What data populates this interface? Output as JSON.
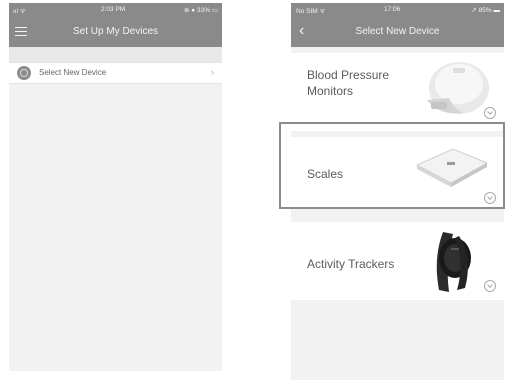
{
  "left_screen": {
    "status": {
      "signal": "ııl ᯤ",
      "time": "2:03 PM",
      "battery": "⊕ ● 33% ▭"
    },
    "title": "Set Up My Devices",
    "menu_item": {
      "label": "Select New Device",
      "chevron": "›"
    }
  },
  "right_screen": {
    "status": {
      "carrier": "No SIM ᯤ",
      "time": "17:06",
      "battery": "➚ 85% ▬"
    },
    "back": "‹",
    "title": "Select New Device",
    "devices": [
      {
        "label": "Blood Pressure Monitors",
        "icon": "blood-pressure-monitor-image"
      },
      {
        "label": "Scales",
        "icon": "scale-image"
      },
      {
        "label": "Activity Trackers",
        "icon": "activity-tracker-image"
      }
    ]
  },
  "colors": {
    "bar": "#8a8a8a",
    "background": "#f2f2f2",
    "card": "#ffffff",
    "highlight": "#8c8c8c"
  }
}
